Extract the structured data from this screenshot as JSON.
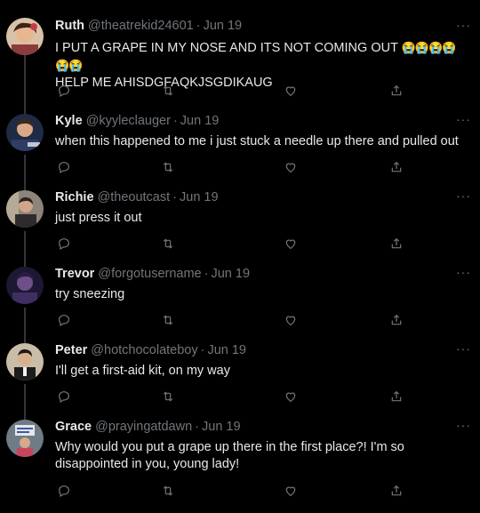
{
  "more_label": "···",
  "tweets": [
    {
      "name": "Ruth",
      "handle": "@theatrekid24601",
      "separator": "·",
      "date": "Jun 19",
      "text": "I PUT A GRAPE IN MY NOSE AND ITS NOT COMING OUT",
      "emoji": "😭😭😭😭😭😭",
      "text2": "HELP ME AHISDGFAQKJSGDIKAUG",
      "avatar_color": "#c9a27a"
    },
    {
      "name": "Kyle",
      "handle": "@kyyleclauger",
      "separator": "·",
      "date": "Jun 19",
      "text": "when this happened to me i just stuck a needle up there and pulled out",
      "avatar_color": "#3a4a6a"
    },
    {
      "name": "Richie",
      "handle": "@theoutcast",
      "separator": "·",
      "date": "Jun 19",
      "text": "just press it out",
      "avatar_color": "#6b6257"
    },
    {
      "name": "Trevor",
      "handle": "@forgotusername",
      "separator": "·",
      "date": "Jun 19",
      "text": "try sneezing",
      "avatar_color": "#3a2d5c"
    },
    {
      "name": "Peter",
      "handle": "@hotchocolateboy",
      "separator": "·",
      "date": "Jun 19",
      "text": "I'll get a first-aid kit, on my way",
      "avatar_color": "#8a7a66"
    },
    {
      "name": "Grace",
      "handle": "@prayingatdawn",
      "separator": "·",
      "date": "Jun 19",
      "text": "Why would you put a grape up there in the first place?! I'm so disappointed in you, young lady!",
      "avatar_color": "#7d8b95"
    }
  ]
}
